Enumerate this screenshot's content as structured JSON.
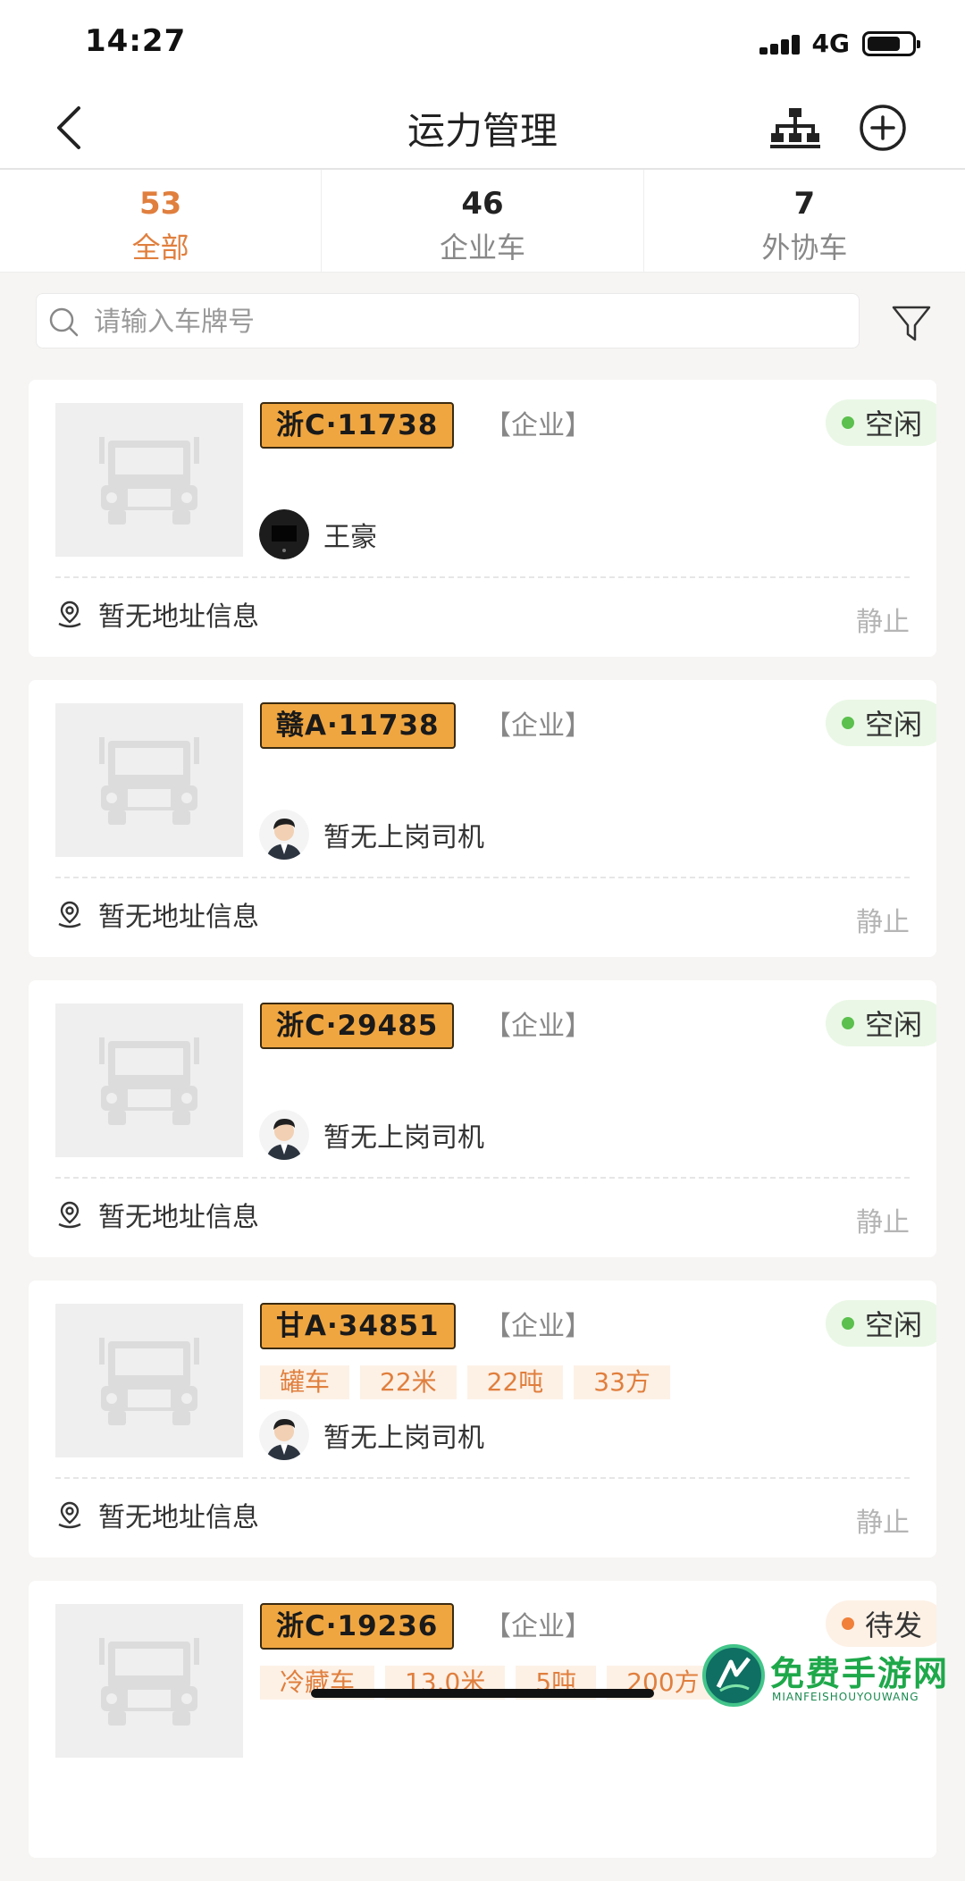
{
  "status_bar": {
    "time": "14:27",
    "network": "4G",
    "battery_level": 0.75
  },
  "nav": {
    "title": "运力管理"
  },
  "tabs": [
    {
      "count": "53",
      "label": "全部",
      "active": true
    },
    {
      "count": "46",
      "label": "企业车",
      "active": false
    },
    {
      "count": "7",
      "label": "外协车",
      "active": false
    }
  ],
  "search": {
    "placeholder": "请输入车牌号",
    "value": ""
  },
  "vehicles": [
    {
      "plate": "浙C·11738",
      "org": "【企业】",
      "status": "空闲",
      "attrs": [],
      "driver": "王豪",
      "address": "暂无地址信息",
      "motion": "静止"
    },
    {
      "plate": "赣A·11738",
      "org": "【企业】",
      "status": "空闲",
      "attrs": [],
      "driver": "暂无上岗司机",
      "address": "暂无地址信息",
      "motion": "静止"
    },
    {
      "plate": "浙C·29485",
      "org": "【企业】",
      "status": "空闲",
      "attrs": [],
      "driver": "暂无上岗司机",
      "address": "暂无地址信息",
      "motion": "静止"
    },
    {
      "plate": "甘A·34851",
      "org": "【企业】",
      "status": "空闲",
      "attrs": [
        "罐车",
        "22米",
        "22吨",
        "33方"
      ],
      "driver": "暂无上岗司机",
      "address": "暂无地址信息",
      "motion": "静止"
    },
    {
      "plate": "浙C·19236",
      "org": "【企业】",
      "status": "待发",
      "attrs": [
        "冷藏车",
        "13.0米",
        "5吨",
        "200方"
      ],
      "driver": "",
      "address": "",
      "motion": ""
    }
  ],
  "watermark": {
    "title": "免费手游网",
    "subtitle": "MIANFEISHOUYOUWANG"
  },
  "colors": {
    "accent": "#e07f3e",
    "plate": "#f0a640",
    "idle": "#5bc04d",
    "pending": "#f0803a"
  }
}
